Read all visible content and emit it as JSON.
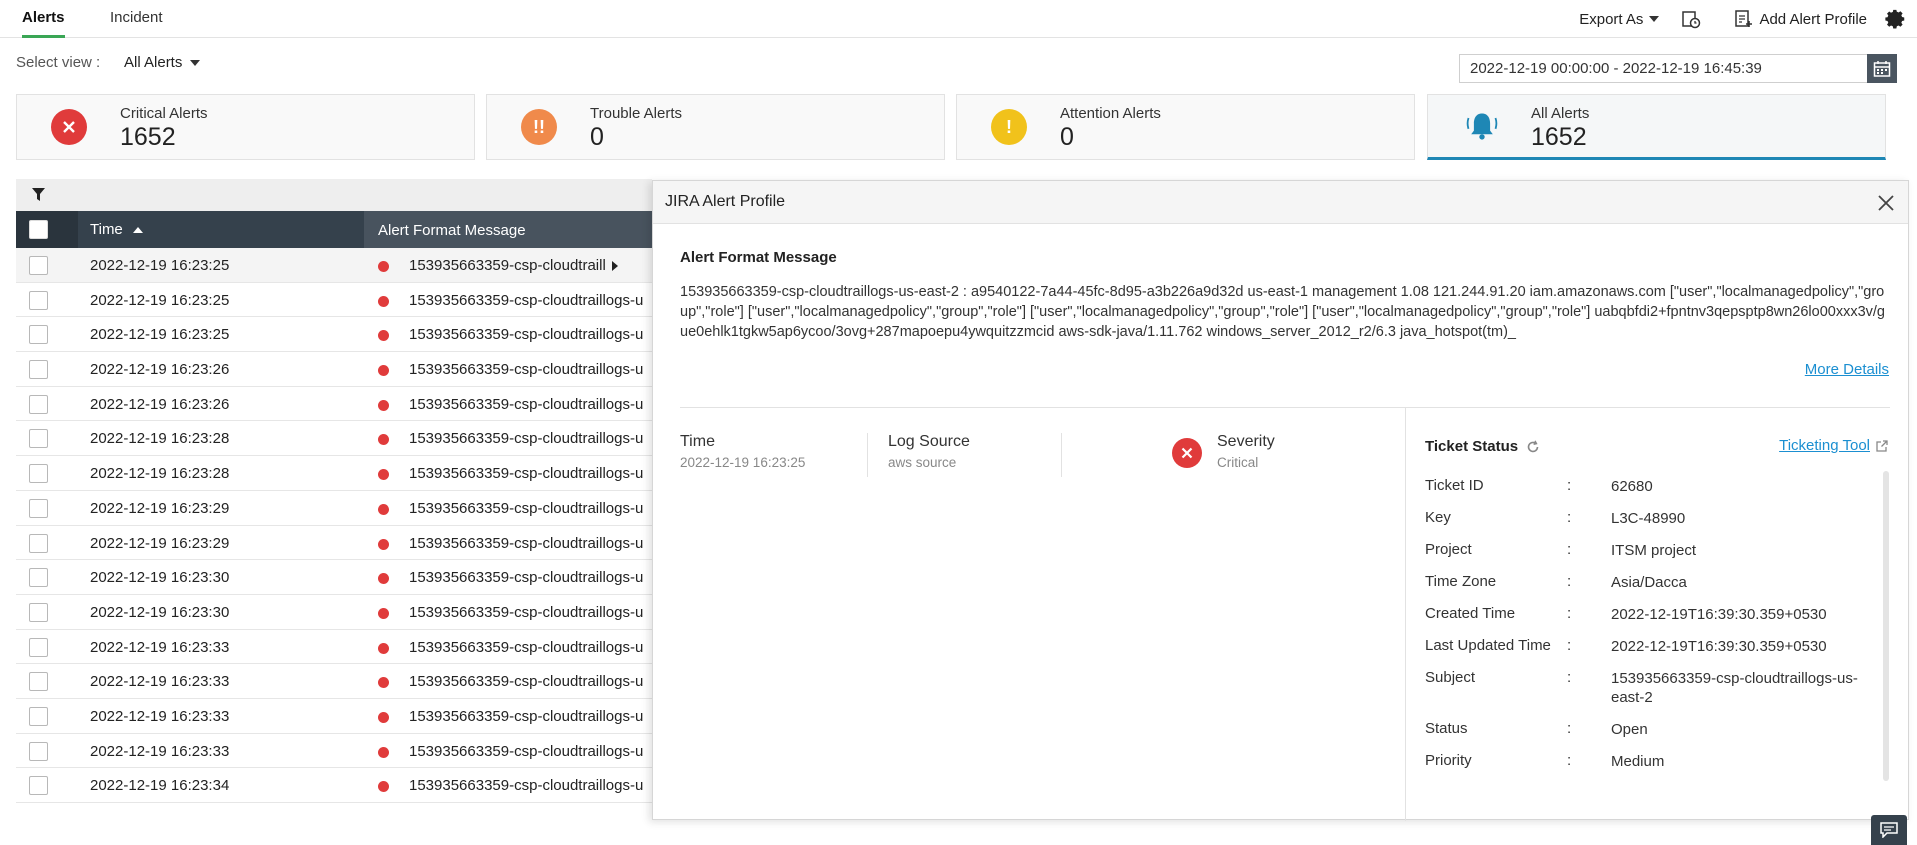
{
  "tabs": [
    {
      "label": "Alerts",
      "active": true
    },
    {
      "label": "Incident",
      "active": false
    }
  ],
  "toolbar": {
    "export_label": "Export As",
    "add_profile_label": "Add Alert Profile"
  },
  "view": {
    "label": "Select view :",
    "selected": "All Alerts"
  },
  "date_range": "2022-12-19 00:00:00 - 2022-12-19 16:45:39",
  "cards": [
    {
      "label": "Critical Alerts",
      "value": "1652",
      "icon": "close-icon",
      "color": "#e03b3b"
    },
    {
      "label": "Trouble Alerts",
      "value": "0",
      "icon": "double-exclamation-icon",
      "color": "#f08a4b"
    },
    {
      "label": "Attention Alerts",
      "value": "0",
      "icon": "exclamation-icon",
      "color": "#f1c21b"
    },
    {
      "label": "All Alerts",
      "value": "1652",
      "icon": "bell-icon",
      "color": "#1e87b5"
    }
  ],
  "table": {
    "columns": [
      "Time",
      "Alert Format Message"
    ],
    "sort_column": "Time",
    "rows": [
      {
        "time": "2022-12-19 16:23:25",
        "message": "153935663359-csp-cloudtraill"
      },
      {
        "time": "2022-12-19 16:23:25",
        "message": "153935663359-csp-cloudtraillogs-u"
      },
      {
        "time": "2022-12-19 16:23:25",
        "message": "153935663359-csp-cloudtraillogs-u"
      },
      {
        "time": "2022-12-19 16:23:26",
        "message": "153935663359-csp-cloudtraillogs-u"
      },
      {
        "time": "2022-12-19 16:23:26",
        "message": "153935663359-csp-cloudtraillogs-u"
      },
      {
        "time": "2022-12-19 16:23:28",
        "message": "153935663359-csp-cloudtraillogs-u"
      },
      {
        "time": "2022-12-19 16:23:28",
        "message": "153935663359-csp-cloudtraillogs-u"
      },
      {
        "time": "2022-12-19 16:23:29",
        "message": "153935663359-csp-cloudtraillogs-u"
      },
      {
        "time": "2022-12-19 16:23:29",
        "message": "153935663359-csp-cloudtraillogs-u"
      },
      {
        "time": "2022-12-19 16:23:30",
        "message": "153935663359-csp-cloudtraillogs-u"
      },
      {
        "time": "2022-12-19 16:23:30",
        "message": "153935663359-csp-cloudtraillogs-u"
      },
      {
        "time": "2022-12-19 16:23:33",
        "message": "153935663359-csp-cloudtraillogs-u"
      },
      {
        "time": "2022-12-19 16:23:33",
        "message": "153935663359-csp-cloudtraillogs-u"
      },
      {
        "time": "2022-12-19 16:23:33",
        "message": "153935663359-csp-cloudtraillogs-u"
      },
      {
        "time": "2022-12-19 16:23:33",
        "message": "153935663359-csp-cloudtraillogs-u"
      },
      {
        "time": "2022-12-19 16:23:34",
        "message": "153935663359-csp-cloudtraillogs-u"
      }
    ]
  },
  "panel": {
    "title": "JIRA Alert Profile",
    "section_title": "Alert Format Message",
    "message": "153935663359-csp-cloudtraillogs-us-east-2 : a9540122-7a44-45fc-8d95-a3b226a9d32d us-east-1 management 1.08 121.244.91.20 iam.amazonaws.com [\"user\",\"localmanagedpolicy\",\"group\",\"role\"] [\"user\",\"localmanagedpolicy\",\"group\",\"role\"] [\"user\",\"localmanagedpolicy\",\"group\",\"role\"] [\"user\",\"localmanagedpolicy\",\"group\",\"role\"] uabqbfdi2+fpntnv3qepsptp8wn26lo00xxx3v/gue0ehlk1tgkw5ap6ycoo/3ovg+287mapoepu4ywquitzzmcid aws-sdk-java/1.11.762 windows_server_2012_r2/6.3 java_hotspot(tm)_",
    "more_details": "More Details",
    "time_label": "Time",
    "time_value": "2022-12-19 16:23:25",
    "log_source_label": "Log Source",
    "log_source_value": "aws source",
    "severity_label": "Severity",
    "severity_value": "Critical",
    "ticket_status_label": "Ticket Status",
    "ticketing_tool_label": "Ticketing Tool",
    "ticket": [
      {
        "key": "Ticket ID",
        "value": "62680"
      },
      {
        "key": "Key",
        "value": "L3C-48990"
      },
      {
        "key": "Project",
        "value": "ITSM project"
      },
      {
        "key": "Time Zone",
        "value": "Asia/Dacca"
      },
      {
        "key": "Created Time",
        "value": "2022-12-19T16:39:30.359+0530"
      },
      {
        "key": "Last Updated Time",
        "value": "2022-12-19T16:39:30.359+0530"
      },
      {
        "key": "Subject",
        "value": "153935663359-csp-cloudtraillogs-us-east-2"
      },
      {
        "key": "Status",
        "value": "Open"
      },
      {
        "key": "Priority",
        "value": "Medium"
      }
    ]
  }
}
